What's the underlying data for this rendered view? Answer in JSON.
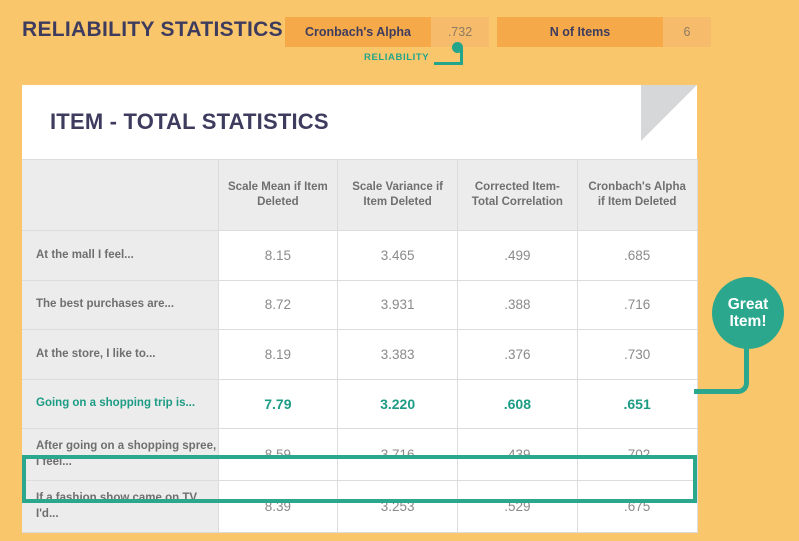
{
  "header": {
    "title": "RELIABILITY STATISTICS",
    "badges": [
      {
        "label": "Cronbach's Alpha",
        "value": ".732"
      },
      {
        "label": "N of Items",
        "value": "6"
      }
    ],
    "annotation": "RELIABILITY"
  },
  "card": {
    "title": "ITEM - TOTAL STATISTICS"
  },
  "table": {
    "columns": [
      "",
      "Scale Mean if Item Deleted",
      "Scale Variance if Item Deleted",
      "Corrected Item- Total Correlation",
      "Cronbach's Alpha if Item Deleted"
    ],
    "rows": [
      {
        "label": "At the mall I feel...",
        "values": [
          "8.15",
          "3.465",
          ".499",
          ".685"
        ],
        "highlighted": false
      },
      {
        "label": "The best purchases are...",
        "values": [
          "8.72",
          "3.931",
          ".388",
          ".716"
        ],
        "highlighted": false
      },
      {
        "label": "At the store, I like to...",
        "values": [
          "8.19",
          "3.383",
          ".376",
          ".730"
        ],
        "highlighted": false
      },
      {
        "label": "Going on a shopping trip is...",
        "values": [
          "7.79",
          "3.220",
          ".608",
          ".651"
        ],
        "highlighted": true
      },
      {
        "label": "After going on a shopping spree, I feel...",
        "values": [
          "8.59",
          "3.716",
          ".439",
          ".702"
        ],
        "highlighted": false
      },
      {
        "label": "If a fashion show came on TV, I'd...",
        "values": [
          "8.39",
          "3.253",
          ".529",
          ".675"
        ],
        "highlighted": false
      }
    ]
  },
  "callout": {
    "line1": "Great",
    "line2": "Item!"
  },
  "colors": {
    "background": "#f9c66b",
    "badge_label": "#f5a949",
    "badge_value": "#f7bc6b",
    "accent_teal": "#2aa78d",
    "title_navy": "#3e3c5e",
    "row_label_bg": "#ececec",
    "text_gray": "#6f6f6f"
  }
}
